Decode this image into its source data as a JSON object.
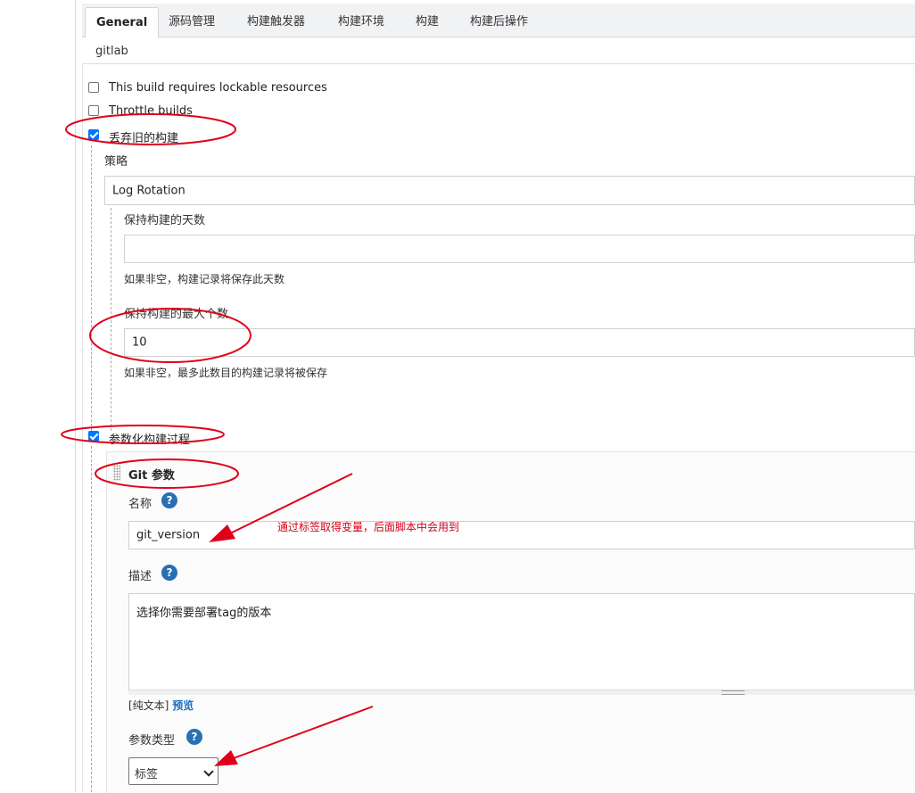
{
  "tabs": [
    {
      "label": "General",
      "active": true
    },
    {
      "label": "源码管理"
    },
    {
      "label": "构建触发器"
    },
    {
      "label": "构建环境"
    },
    {
      "label": "构建"
    },
    {
      "label": "构建后操作"
    }
  ],
  "description_value": "gitlab",
  "options": {
    "lockable": {
      "label": "This build requires lockable resources",
      "checked": false
    },
    "throttle": {
      "label": "Throttle builds",
      "checked": false
    },
    "discard_old": {
      "label": "丢弃旧的构建",
      "checked": true
    },
    "parameterized": {
      "label": "参数化构建过程",
      "checked": true
    }
  },
  "strategy": {
    "label": "策略",
    "value": "Log Rotation",
    "days_to_keep": {
      "label": "保持构建的天数",
      "value": "",
      "hint": "如果非空，构建记录将保存此天数"
    },
    "max_builds": {
      "label": "保持构建的最大个数",
      "value": "10",
      "hint": "如果非空，最多此数目的构建记录将被保存"
    }
  },
  "git_param": {
    "title": "Git 参数",
    "name_label": "名称",
    "name_value": "git_version",
    "desc_label": "描述",
    "desc_value": "选择你需要部署tag的版本",
    "format_prefix": "[纯文本]",
    "preview_label": "预览",
    "type_label": "参数类型",
    "type_value": "标签",
    "help_icon_text": "?"
  },
  "annotation": {
    "text": "通过标签取得变量，后面脚本中会用到",
    "color": "#d2001a"
  }
}
